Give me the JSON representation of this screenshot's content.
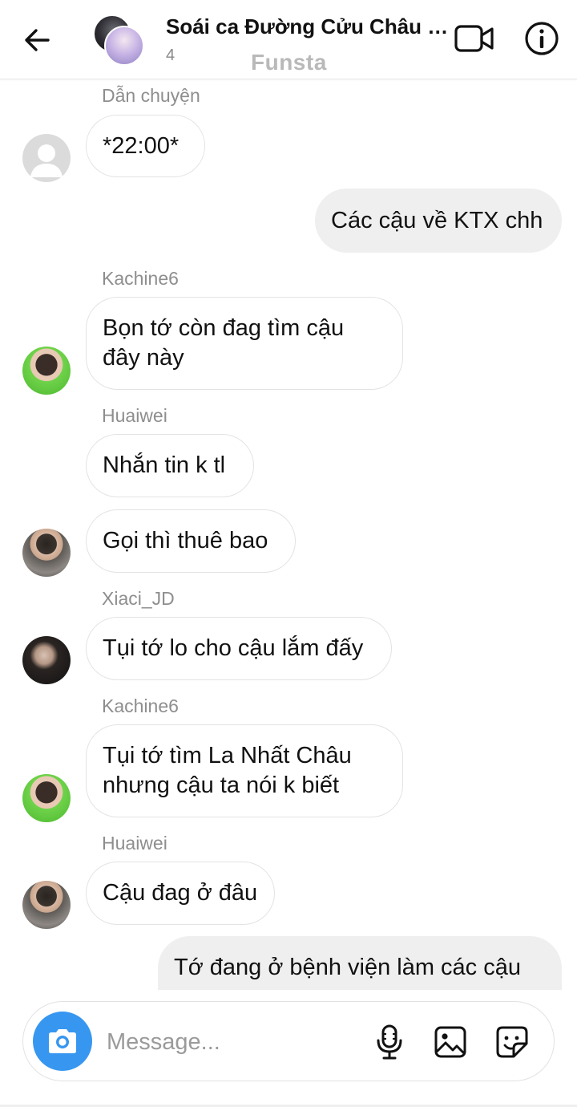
{
  "header": {
    "title": "Soái ca Đường Cửu Châu và ...",
    "member_count": "4",
    "watermark": "Funsta"
  },
  "messages": [
    {
      "sender": "Dẫn chuyện",
      "text": "*22:00*",
      "direction": "incoming",
      "avatar": "default-avatar-icon"
    },
    {
      "sender": "",
      "text": "Các cậu về KTX chh",
      "direction": "outgoing"
    },
    {
      "sender": "Kachine6",
      "text": "Bọn tớ còn đag tìm cậu đây này",
      "direction": "incoming",
      "avatar": "green-shirt-photo"
    },
    {
      "sender": "Huaiwei",
      "text": "Nhắn tin k tl",
      "direction": "incoming"
    },
    {
      "sender": "",
      "text": "Gọi thì thuê bao",
      "direction": "incoming",
      "avatar": "jacket-photo"
    },
    {
      "sender": "Xiaci_JD",
      "text": "Tụi tớ lo cho cậu lắm đấy",
      "direction": "incoming",
      "avatar": "dark-portrait-photo"
    },
    {
      "sender": "Kachine6",
      "text": "Tụi tớ tìm La Nhất Châu nhưng cậu ta nói k biết",
      "direction": "incoming",
      "avatar": "green-shirt-photo"
    },
    {
      "sender": "Huaiwei",
      "text": "Cậu đag ở đâu",
      "direction": "incoming",
      "avatar": "jacket-photo"
    },
    {
      "sender": "",
      "text": "Tớ đang ở bệnh viện làm các cậu",
      "direction": "outgoing"
    }
  ],
  "composer": {
    "placeholder": "Message..."
  },
  "icons": {
    "back": "arrow-left-icon",
    "video": "video-camera-icon",
    "info": "info-icon",
    "camera": "camera-icon",
    "mic": "microphone-icon",
    "gallery": "image-icon",
    "sticker": "sticker-icon"
  },
  "colors": {
    "accent": "#3797f0",
    "outgoing_bubble": "#efefef",
    "incoming_border": "#e3e3e3",
    "secondary_text": "#8e8e8e"
  }
}
